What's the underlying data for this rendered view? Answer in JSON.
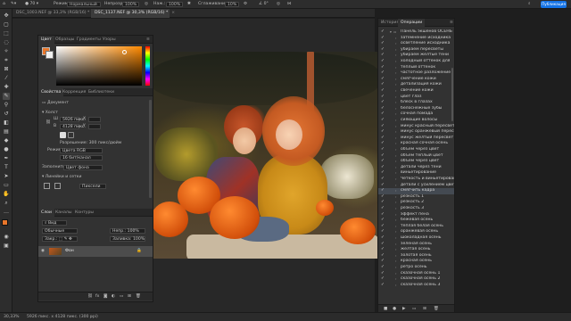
{
  "options_bar": {
    "mode_label": "Режим:",
    "mode_value": "Нормальный",
    "opacity_label": "Непрозр.:",
    "opacity_value": "100%",
    "flow_value": "100%",
    "smoothing_label": "Сглаживание:",
    "smoothing_value": "10%",
    "publish_label": "Публикация"
  },
  "document_tabs": [
    {
      "label": "DSC_1003.NEF @ 33,3% (RGB/16) *",
      "active": false
    },
    {
      "label": "DSC_1137.NEF @ 30,3% (RGB/16) *",
      "active": true
    }
  ],
  "color_panel": {
    "tabs": [
      "Цвет",
      "Образцы",
      "Градиенты",
      "Узоры"
    ],
    "active_tab": "Цвет",
    "fg_color": "#e8762a",
    "bg_color": "#f0f0f0"
  },
  "properties_panel": {
    "tabs": [
      "Свойства",
      "Коррекция",
      "Библиотеки"
    ],
    "active_tab": "Свойства",
    "doc_label": "Документ",
    "canvas_section": "Холст",
    "width_label": "Ш",
    "width_value": "5926 пикс.",
    "height_label": "В",
    "height_value": "4128 пикс.",
    "x_label": "X",
    "y_label": "Y",
    "resolution_label": "Разрешение: 300 пикс/дюйм",
    "mode_label": "Режим",
    "mode_value": "Цвета RGB",
    "depth_value": "16 бит/канал",
    "fill_label": "Заполнить",
    "fill_value": "Цвет фона",
    "rulers_section": "Линейки и сетки",
    "units_value": "Пиксели"
  },
  "layers_panel": {
    "tabs": [
      "Слои",
      "Каналы",
      "Контуры"
    ],
    "active_tab": "Слои",
    "layer_name": "Фон"
  },
  "actions_panel": {
    "tabs": [
      "История",
      "Операции"
    ],
    "active_tab": "Операции",
    "set_name": "Панель экшенов ОСЕНЬ",
    "items": [
      "затемнение исходника",
      "осветление исходника",
      "убираем пересветы",
      "убираем желтые тени",
      "холодный оттенок для",
      "теплый оттенок",
      "частотное разложение",
      "смягчение кожи",
      "детализация кожи",
      "свечение кожи",
      "цвет глаз",
      "блеск в глазах",
      "белоснежные зубы",
      "сочная помада",
      "сияющие волосы",
      "минус красный пересвет",
      "минус оранжевый пересвет",
      "минус желтый пересвет",
      "красная сочная осень",
      "объем через цвет",
      "объем теплый цвет",
      "объем через цвет",
      "детали через тени",
      "виньетирование",
      "Четкость и виньетирование",
      "детали с усилением цвета",
      "смягчить кадра",
      "резкость 1",
      "резкость 2",
      "резкость 3",
      "эффект пена",
      "бежевая осень",
      "теплая белая осень",
      "оранжевая осень",
      "шоколадная осень",
      "зеленая осень",
      "желтая осень",
      "золотая осень",
      "красная осень",
      "ретро осень",
      "сказочная осень 1",
      "сказочная осень 2",
      "сказочная осень 3"
    ],
    "highlighted_index": 26
  },
  "status_bar": {
    "zoom": "30,33%",
    "doc_info": "5926 пикс. x 4128 пикс. (300 ppi)"
  }
}
